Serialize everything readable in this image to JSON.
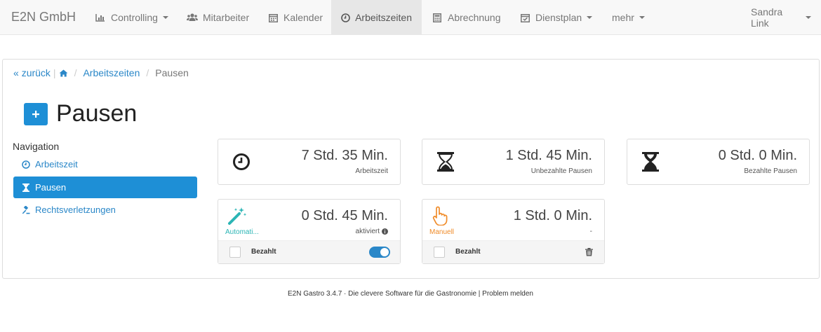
{
  "navbar": {
    "brand": "E2N GmbH",
    "items": [
      {
        "label": "Controlling",
        "icon": "bar-chart-icon"
      },
      {
        "label": "Mitarbeiter",
        "icon": "users-icon"
      },
      {
        "label": "Kalender",
        "icon": "calendar-icon"
      },
      {
        "label": "Arbeitszeiten",
        "icon": "clock-icon"
      },
      {
        "label": "Abrechnung",
        "icon": "calculator-icon"
      },
      {
        "label": "Dienstplan",
        "icon": "calendar-check-icon"
      },
      {
        "label": "mehr",
        "icon": ""
      }
    ],
    "user": "Sandra Link"
  },
  "breadcrumb": {
    "back": "zurück",
    "section": "Arbeitszeiten",
    "current": "Pausen"
  },
  "page": {
    "title": "Pausen"
  },
  "sidebar": {
    "heading": "Navigation",
    "items": [
      {
        "label": "Arbeitszeit"
      },
      {
        "label": "Pausen"
      },
      {
        "label": "Rechtsverletzungen"
      }
    ]
  },
  "cards": {
    "arbeitszeit": {
      "value": "7 Std. 35 Min.",
      "label": "Arbeitszeit"
    },
    "unbezahlt": {
      "value": "1 Std. 45 Min.",
      "label": "Unbezahlte Pausen"
    },
    "bezahlt": {
      "value": "0 Std. 0 Min.",
      "label": "Bezahlte Pausen"
    },
    "automatisch": {
      "value": "0 Std. 45 Min.",
      "type": "Automati...",
      "status": "aktiviert",
      "checkbox_label": "Bezahlt"
    },
    "manuell": {
      "value": "1 Std. 0 Min.",
      "type": "Manuell",
      "status": "-",
      "checkbox_label": "Bezahlt"
    }
  },
  "colors": {
    "primary": "#1e8fd6",
    "link": "#2a87c8",
    "teal": "#2bb5b5",
    "orange": "#f08c2a"
  },
  "footer": {
    "text": "E2N Gastro 3.4.7 · Die clevere Software für die Gastronomie | Problem melden"
  }
}
